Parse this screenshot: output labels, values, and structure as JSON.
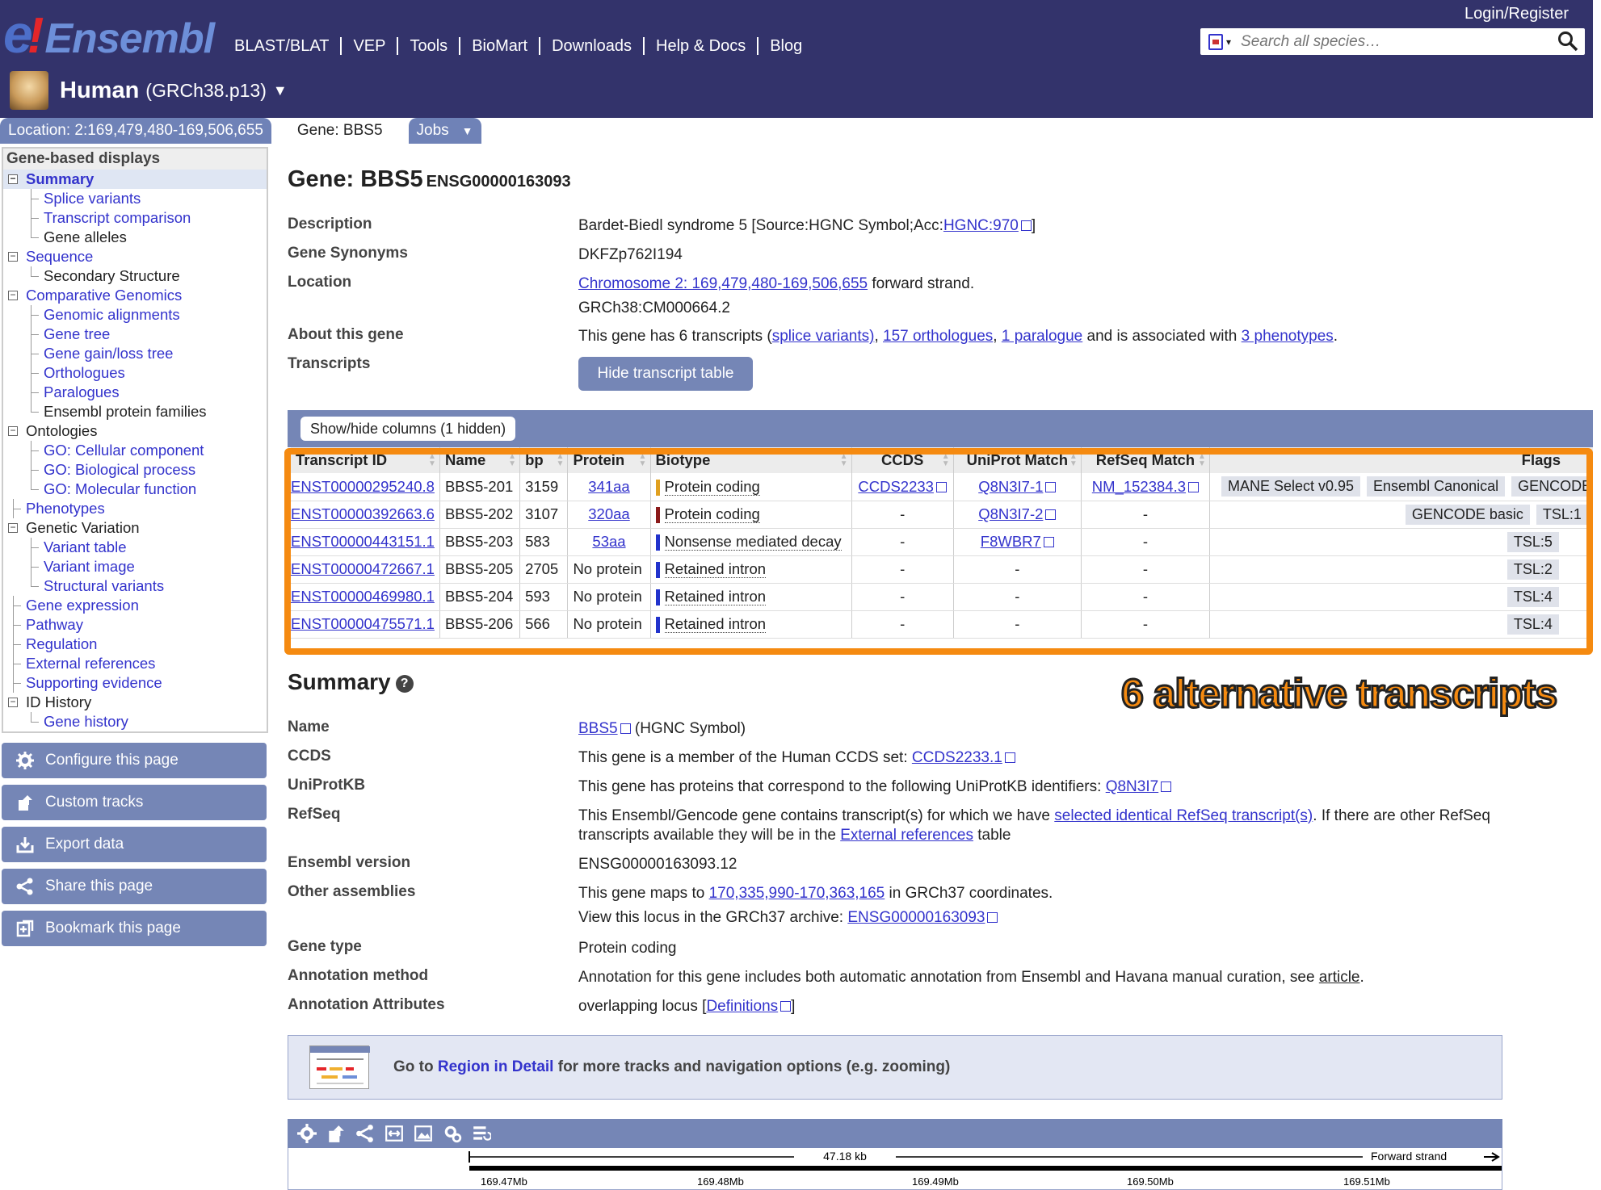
{
  "header": {
    "logo": {
      "e": "e",
      "bang": "!",
      "word": "Ensembl"
    },
    "nav": [
      "BLAST/BLAT",
      "VEP",
      "Tools",
      "BioMart",
      "Downloads",
      "Help & Docs",
      "Blog"
    ],
    "login": "Login/Register",
    "search_placeholder": "Search all species…",
    "species": {
      "name": "Human",
      "assembly": "(GRCh38.p13)",
      "dropdown": "▼"
    }
  },
  "tabs": [
    {
      "label": "Location: 2:169,479,480-169,506,655"
    },
    {
      "label": "Gene: BBS5"
    },
    {
      "label": "Jobs",
      "chevron": "▼"
    }
  ],
  "sidebar": {
    "heading": "Gene-based displays",
    "items": [
      {
        "label": "Summary",
        "level": 1,
        "box": "⊟",
        "style": "active"
      },
      {
        "label": "Splice variants",
        "level": 2,
        "style": "link"
      },
      {
        "label": "Transcript comparison",
        "level": 2,
        "style": "link"
      },
      {
        "label": "Gene alleles",
        "level": 2,
        "style": "dark"
      },
      {
        "label": "Sequence",
        "level": 1,
        "box": "⊟",
        "style": "link"
      },
      {
        "label": "Secondary Structure",
        "level": 2,
        "style": "dark"
      },
      {
        "label": "Comparative Genomics",
        "level": 1,
        "box": "⊟",
        "style": "link"
      },
      {
        "label": "Genomic alignments",
        "level": 2,
        "style": "link"
      },
      {
        "label": "Gene tree",
        "level": 2,
        "style": "link"
      },
      {
        "label": "Gene gain/loss tree",
        "level": 2,
        "style": "link"
      },
      {
        "label": "Orthologues",
        "level": 2,
        "style": "link"
      },
      {
        "label": "Paralogues",
        "level": 2,
        "style": "link"
      },
      {
        "label": "Ensembl protein families",
        "level": 2,
        "style": "dark"
      },
      {
        "label": "Ontologies",
        "level": 1,
        "box": "⊟",
        "style": "dark"
      },
      {
        "label": "GO: Cellular component",
        "level": 2,
        "style": "link"
      },
      {
        "label": "GO: Biological process",
        "level": 2,
        "style": "link"
      },
      {
        "label": "GO: Molecular function",
        "level": 2,
        "style": "link"
      },
      {
        "label": "Phenotypes",
        "level": 1,
        "style": "link"
      },
      {
        "label": "Genetic Variation",
        "level": 1,
        "box": "⊟",
        "style": "dark"
      },
      {
        "label": "Variant table",
        "level": 2,
        "style": "link"
      },
      {
        "label": "Variant image",
        "level": 2,
        "style": "link"
      },
      {
        "label": "Structural variants",
        "level": 2,
        "style": "link"
      },
      {
        "label": "Gene expression",
        "level": 1,
        "style": "link"
      },
      {
        "label": "Pathway",
        "level": 1,
        "style": "link"
      },
      {
        "label": "Regulation",
        "level": 1,
        "style": "link"
      },
      {
        "label": "External references",
        "level": 1,
        "style": "link"
      },
      {
        "label": "Supporting evidence",
        "level": 1,
        "style": "link"
      },
      {
        "label": "ID History",
        "level": 1,
        "box": "⊟",
        "style": "dark"
      },
      {
        "label": "Gene history",
        "level": 2,
        "style": "link"
      }
    ],
    "buttons": [
      {
        "label": "Configure this page",
        "icon": "gear-icon"
      },
      {
        "label": "Custom tracks",
        "icon": "upload-icon"
      },
      {
        "label": "Export data",
        "icon": "export-icon"
      },
      {
        "label": "Share this page",
        "icon": "share-icon"
      },
      {
        "label": "Bookmark this page",
        "icon": "bookmark-icon"
      }
    ]
  },
  "gene": {
    "title": "Gene: BBS5",
    "id": "ENSG00000163093",
    "description": {
      "label": "Description",
      "text": "Bardet-Biedl syndrome 5 [Source:HGNC Symbol;Acc:",
      "link": "HGNC:970",
      "tail": "]"
    },
    "synonyms": {
      "label": "Gene Synonyms",
      "value": "DKFZp762I194"
    },
    "location": {
      "label": "Location",
      "link": "Chromosome 2: 169,479,480-169,506,655",
      "tail": " forward strand.",
      "line2": "GRCh38:CM000664.2"
    },
    "about": {
      "label": "About this gene",
      "t1": "This gene has 6 transcripts (",
      "l1": "splice variants)",
      "t2": ", ",
      "l2": "157 orthologues",
      "t3": ", ",
      "l3": "1 paralogue",
      "t4": " and is associated with ",
      "l4": "3 phenotypes",
      "t5": "."
    },
    "transcripts_label": "Transcripts",
    "hide_button": "Hide transcript table"
  },
  "table": {
    "show_hide": "Show/hide columns (1 hidden)",
    "headers": [
      "Transcript ID",
      "Name",
      "bp",
      "Protein",
      "Biotype",
      "CCDS",
      "UniProt Match",
      "RefSeq Match",
      "Flags"
    ],
    "rows": [
      {
        "id": "ENST00000295240.8",
        "name": "BBS5-201",
        "bp": "3159",
        "protein": "341aa",
        "protein_link": true,
        "biotype": "Protein coding",
        "bt_color": "gold",
        "ccds": "CCDS2233",
        "uniprot": "Q8N3I7-1",
        "refseq": "NM_152384.3",
        "flags": [
          "MANE Select v0.95",
          "Ensembl Canonical",
          "GENCODE basic"
        ]
      },
      {
        "id": "ENST00000392663.6",
        "name": "BBS5-202",
        "bp": "3107",
        "protein": "320aa",
        "protein_link": true,
        "biotype": "Protein coding",
        "bt_color": "red",
        "ccds": "-",
        "uniprot": "Q8N3I7-2",
        "refseq": "-",
        "flags": [
          "GENCODE basic",
          "TSL:1"
        ]
      },
      {
        "id": "ENST00000443151.1",
        "name": "BBS5-203",
        "bp": "583",
        "protein": "53aa",
        "protein_link": true,
        "biotype": "Nonsense mediated decay",
        "bt_color": "blue",
        "ccds": "-",
        "uniprot": "F8WBR7",
        "refseq": "-",
        "flags": [
          "TSL:5"
        ]
      },
      {
        "id": "ENST00000472667.1",
        "name": "BBS5-205",
        "bp": "2705",
        "protein": "No protein",
        "protein_link": false,
        "biotype": "Retained intron",
        "bt_color": "blue",
        "ccds": "-",
        "uniprot": "-",
        "refseq": "-",
        "flags": [
          "TSL:2"
        ]
      },
      {
        "id": "ENST00000469980.1",
        "name": "BBS5-204",
        "bp": "593",
        "protein": "No protein",
        "protein_link": false,
        "biotype": "Retained intron",
        "bt_color": "blue",
        "ccds": "-",
        "uniprot": "-",
        "refseq": "-",
        "flags": [
          "TSL:4"
        ]
      },
      {
        "id": "ENST00000475571.1",
        "name": "BBS5-206",
        "bp": "566",
        "protein": "No protein",
        "protein_link": false,
        "biotype": "Retained intron",
        "bt_color": "blue",
        "ccds": "-",
        "uniprot": "-",
        "refseq": "-",
        "flags": [
          "TSL:4"
        ]
      }
    ]
  },
  "annotation": "6 alternative transcripts",
  "summary": {
    "heading": "Summary",
    "name": {
      "label": "Name",
      "link": "BBS5",
      "tail": " (HGNC Symbol)"
    },
    "ccds": {
      "label": "CCDS",
      "text": "This gene is a member of the Human CCDS set: ",
      "link": "CCDS2233.1"
    },
    "uniprot": {
      "label": "UniProtKB",
      "text": "This gene has proteins that correspond to the following UniProtKB identifiers: ",
      "link": "Q8N3I7"
    },
    "refseq": {
      "label": "RefSeq",
      "t1": "This Ensembl/Gencode gene contains transcript(s) for which we have ",
      "l1": "selected identical RefSeq transcript(s)",
      "t2": ". If there are other RefSeq",
      "t3": "transcripts available they will be in the ",
      "l2": "External references",
      "t4": " table"
    },
    "version": {
      "label": "Ensembl version",
      "value": "ENSG00000163093.12"
    },
    "other": {
      "label": "Other assemblies",
      "t1": "This gene maps to ",
      "l1": "170,335,990-170,363,165",
      "t2": " in GRCh37 coordinates.",
      "t3": "View this locus in the GRCh37 archive: ",
      "l2": "ENSG00000163093"
    },
    "gene_type": {
      "label": "Gene type",
      "value": "Protein coding"
    },
    "method": {
      "label": "Annotation method",
      "text": "Annotation for this gene includes both automatic annotation from Ensembl and Havana manual curation, see ",
      "link": "article",
      "tail": "."
    },
    "attrs": {
      "label": "Annotation Attributes",
      "text": "overlapping locus [",
      "link": "Definitions",
      "tail": "]"
    }
  },
  "region": {
    "t1": "Go to ",
    "link": "Region in Detail",
    "t2": " for more tracks and navigation options (e.g. zooming)"
  },
  "image": {
    "scale_label": "47.18 kb",
    "strand": "Forward strand",
    "ticks": [
      "169.47Mb",
      "169.48Mb",
      "169.49Mb",
      "169.50Mb",
      "169.51Mb"
    ]
  },
  "colors": {
    "masthead": "#33336b",
    "accent": "#7586b6",
    "highlight": "#f58a10",
    "link": "#3333cc"
  }
}
